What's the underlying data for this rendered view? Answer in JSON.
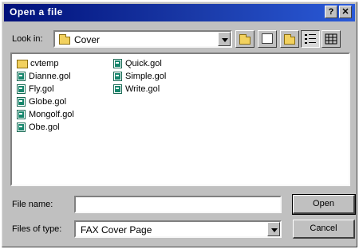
{
  "window": {
    "title": "Open a file",
    "help_label": "?",
    "close_label": "✕"
  },
  "look_in": {
    "label": "Look in:",
    "value": "Cover"
  },
  "toolbar": {
    "up_folder_icon": "up-folder-icon",
    "desktop_icon": "desktop-icon",
    "new_folder_icon": "new-folder-icon",
    "list_view_icon": "list-view-icon",
    "details_view_icon": "details-view-icon"
  },
  "files": {
    "column1": [
      {
        "name": "cvtemp",
        "type": "folder"
      },
      {
        "name": "Dianne.gol",
        "type": "file"
      },
      {
        "name": "Fly.gol",
        "type": "file"
      },
      {
        "name": "Globe.gol",
        "type": "file"
      },
      {
        "name": "Mongolf.gol",
        "type": "file"
      },
      {
        "name": "Obe.gol",
        "type": "file"
      }
    ],
    "column2": [
      {
        "name": "Quick.gol",
        "type": "file"
      },
      {
        "name": "Simple.gol",
        "type": "file"
      },
      {
        "name": "Write.gol",
        "type": "file"
      }
    ]
  },
  "file_name": {
    "label": "File name:",
    "value": ""
  },
  "file_type": {
    "label": "Files of type:",
    "value": "FAX Cover Page"
  },
  "buttons": {
    "open": "Open",
    "cancel": "Cancel"
  },
  "colors": {
    "title_bar": "#00107a",
    "face": "#c0c0c0",
    "file_icon": "#16866c",
    "folder": "#f2d15e"
  }
}
